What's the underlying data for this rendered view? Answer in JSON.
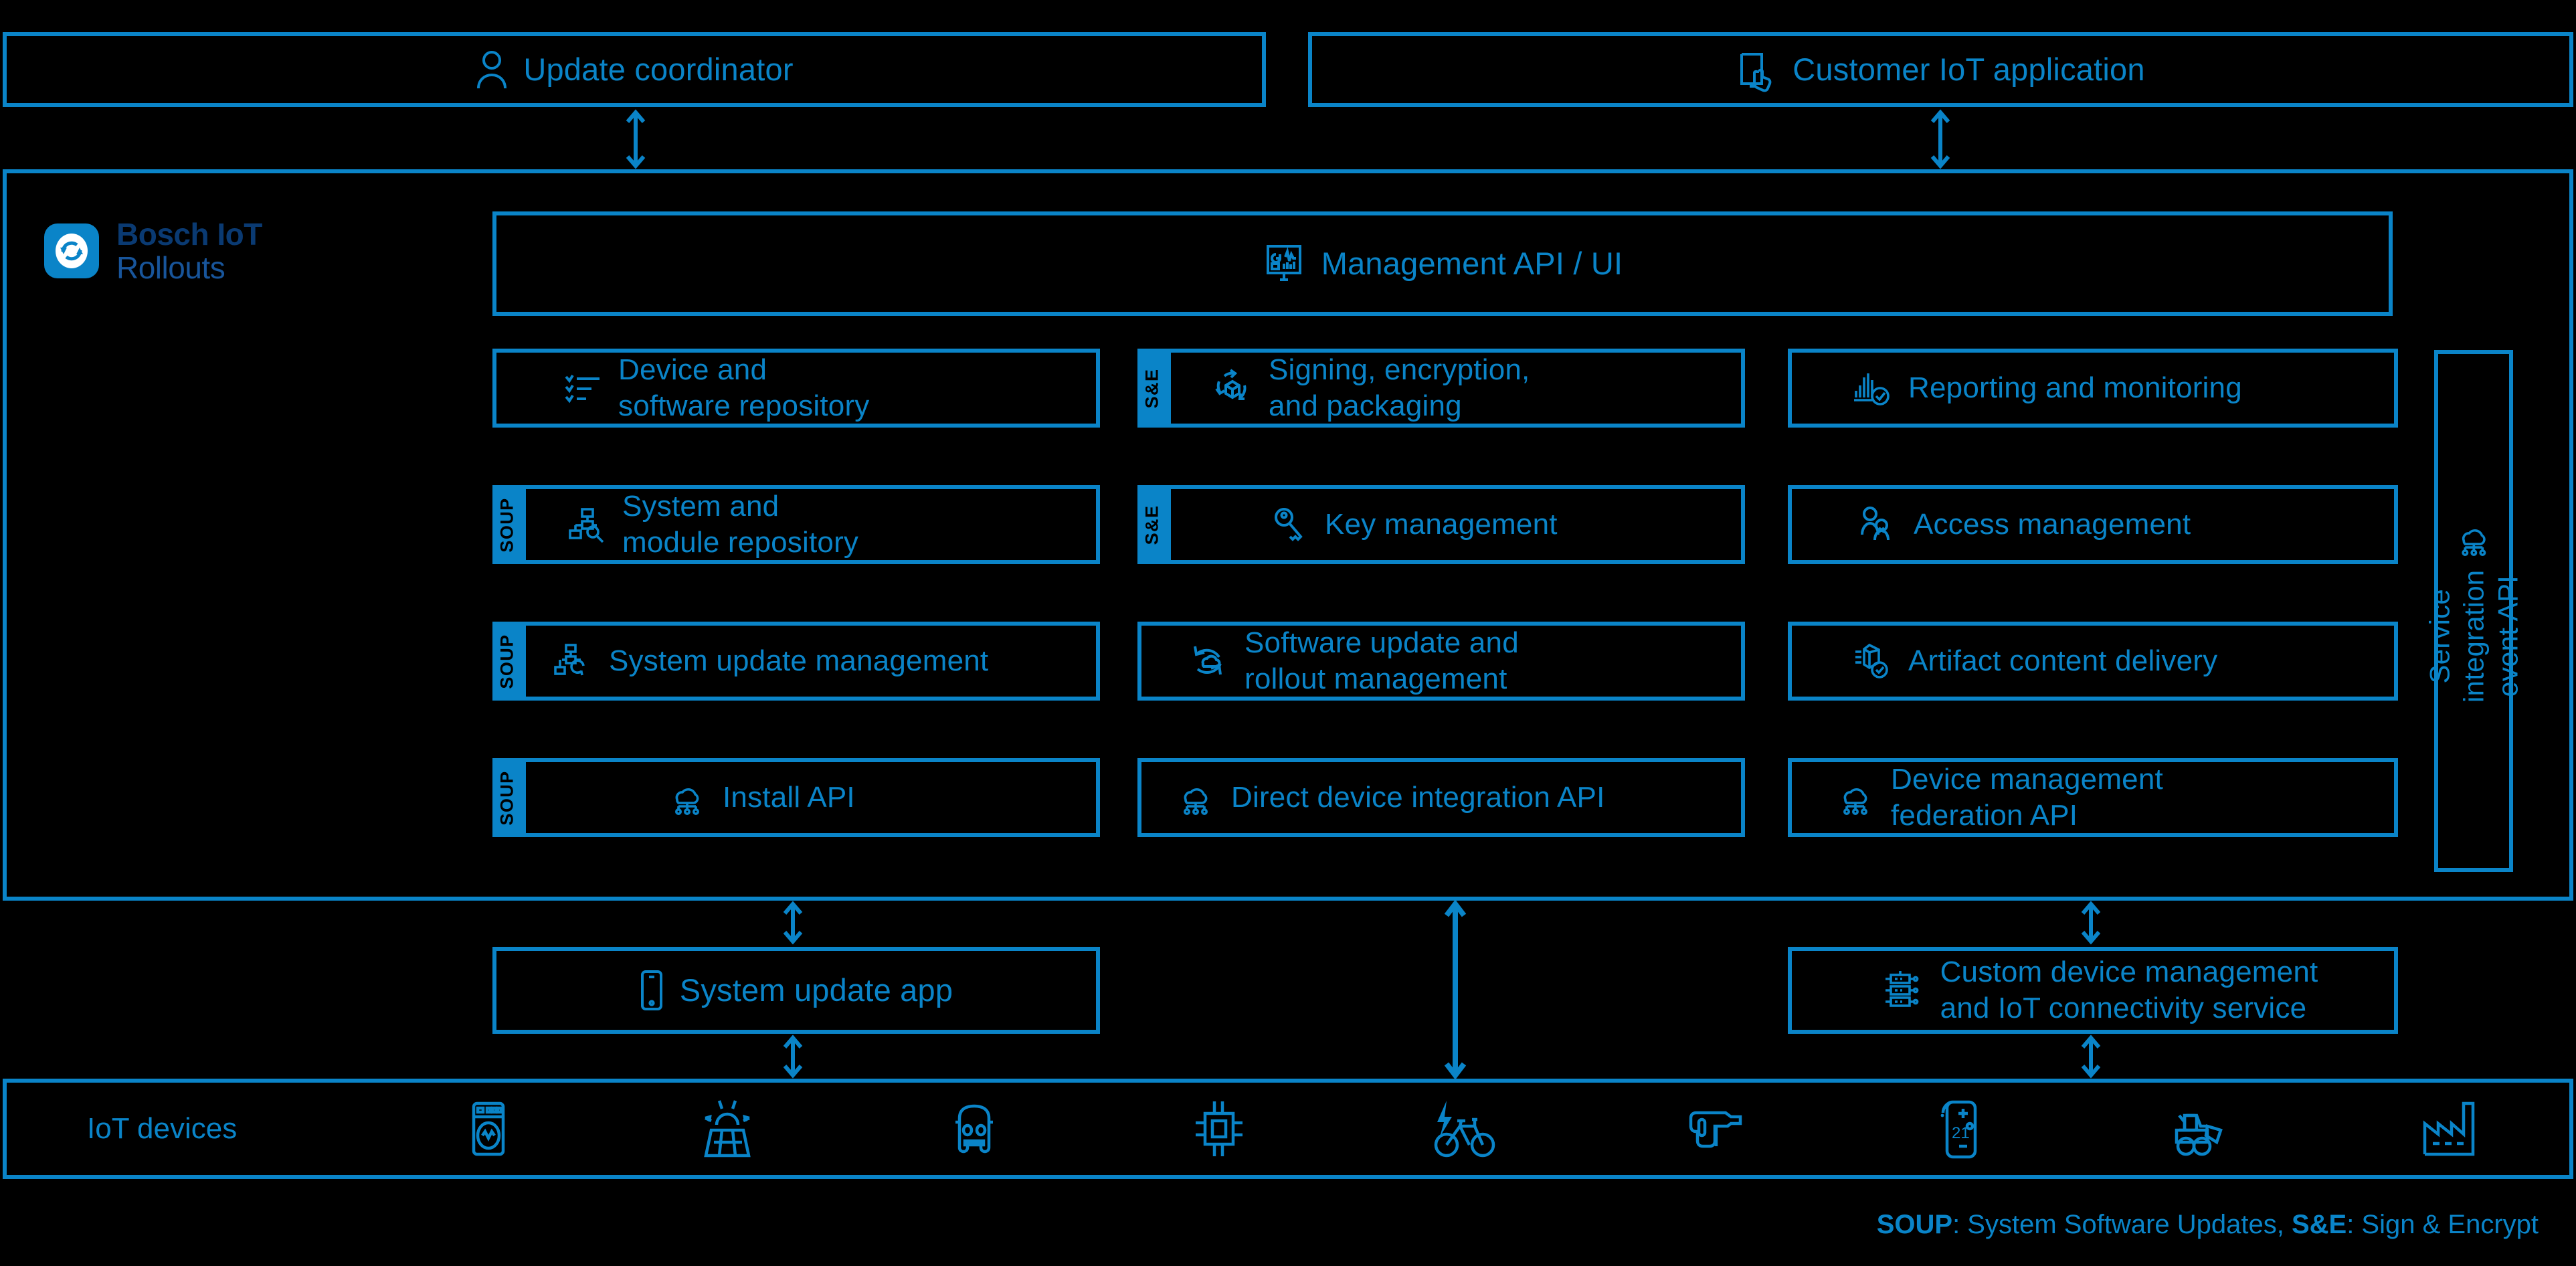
{
  "theme": {
    "background": "#000000",
    "accent": "#0a84c8",
    "logo_dark": "#0a3a72",
    "logo_mid": "#18559b",
    "tag_text": "#000000"
  },
  "actors": [
    {
      "id": "update-coordinator",
      "label": "Update coordinator",
      "icon": "user-icon"
    },
    {
      "id": "customer-iot-application",
      "label": "Customer IoT application",
      "icon": "tablet-touch-icon"
    }
  ],
  "platform": {
    "logo": {
      "line1": "Bosch IoT",
      "line2": "Rollouts",
      "icon": "sync-refresh-icon"
    },
    "management_bar": {
      "label": "Management API / UI",
      "icon": "dashboard-monitor-icon"
    },
    "cards": [
      {
        "id": "device-and-software-repository",
        "label": "Device and\nsoftware repository",
        "icon": "checklist-icon",
        "tag": "",
        "col": 0,
        "row": 0
      },
      {
        "id": "signing-encryption-and-packaging",
        "label": "Signing, encryption,\nand packaging",
        "icon": "package-cycle-icon",
        "tag": "S&E",
        "col": 1,
        "row": 0
      },
      {
        "id": "reporting-and-monitoring",
        "label": "Reporting and monitoring",
        "icon": "bar-chart-check-icon",
        "tag": "",
        "col": 2,
        "row": 0
      },
      {
        "id": "system-and-module-repository",
        "label": "System and\nmodule repository",
        "icon": "module-search-icon",
        "tag": "SOUP",
        "col": 0,
        "row": 1
      },
      {
        "id": "key-management",
        "label": "Key management",
        "icon": "key-icon",
        "tag": "S&E",
        "col": 1,
        "row": 1
      },
      {
        "id": "access-management",
        "label": "Access management",
        "icon": "users-access-icon",
        "tag": "",
        "col": 2,
        "row": 1
      },
      {
        "id": "system-update-management",
        "label": "System update management",
        "icon": "hierarchy-refresh-icon",
        "tag": "SOUP",
        "col": 0,
        "row": 2
      },
      {
        "id": "software-update-and-rollout-management",
        "label": "Software update and\nrollout management",
        "icon": "cloud-cycle-icon",
        "tag": "",
        "col": 1,
        "row": 2
      },
      {
        "id": "artifact-content-delivery",
        "label": "Artifact content delivery",
        "icon": "artifact-check-icon",
        "tag": "",
        "col": 2,
        "row": 2
      },
      {
        "id": "install-api",
        "label": "Install API",
        "icon": "cloud-network-icon",
        "tag": "SOUP",
        "col": 0,
        "row": 3
      },
      {
        "id": "direct-device-integration-api",
        "label": "Direct device integration API",
        "icon": "cloud-network-icon",
        "tag": "",
        "col": 1,
        "row": 3
      },
      {
        "id": "device-management-federation-api",
        "label": "Device management\nfederation API",
        "icon": "cloud-network-icon",
        "tag": "",
        "col": 2,
        "row": 3
      }
    ],
    "side_panel": {
      "id": "service-integration-event-api",
      "label": "Service integration\nevent API",
      "icon": "cloud-network-icon"
    }
  },
  "consumers": [
    {
      "id": "system-update-app",
      "label": "System update app",
      "icon": "smartphone-icon"
    },
    {
      "id": "custom-device-management-and-iot-connectivity-service",
      "label": "Custom device management\nand IoT connectivity service",
      "icon": "servers-icon"
    }
  ],
  "iot_bar": {
    "title": "IoT devices",
    "devices": [
      {
        "id": "washing-machine",
        "icon": "washing-machine-icon"
      },
      {
        "id": "solar-panel",
        "icon": "solar-panel-icon"
      },
      {
        "id": "car",
        "icon": "car-icon"
      },
      {
        "id": "microchip",
        "icon": "microchip-icon"
      },
      {
        "id": "e-bike",
        "icon": "e-bike-icon"
      },
      {
        "id": "power-tool",
        "icon": "power-drill-icon"
      },
      {
        "id": "thermostat",
        "icon": "thermostat-icon",
        "value": "21"
      },
      {
        "id": "construction-vehicle",
        "icon": "excavator-icon"
      },
      {
        "id": "factory",
        "icon": "factory-icon"
      }
    ]
  },
  "legend": {
    "soup_abbr": "SOUP",
    "soup_text": ": System Software Updates, ",
    "se_abbr": "S&E",
    "se_text": ": Sign & Encrypt"
  }
}
